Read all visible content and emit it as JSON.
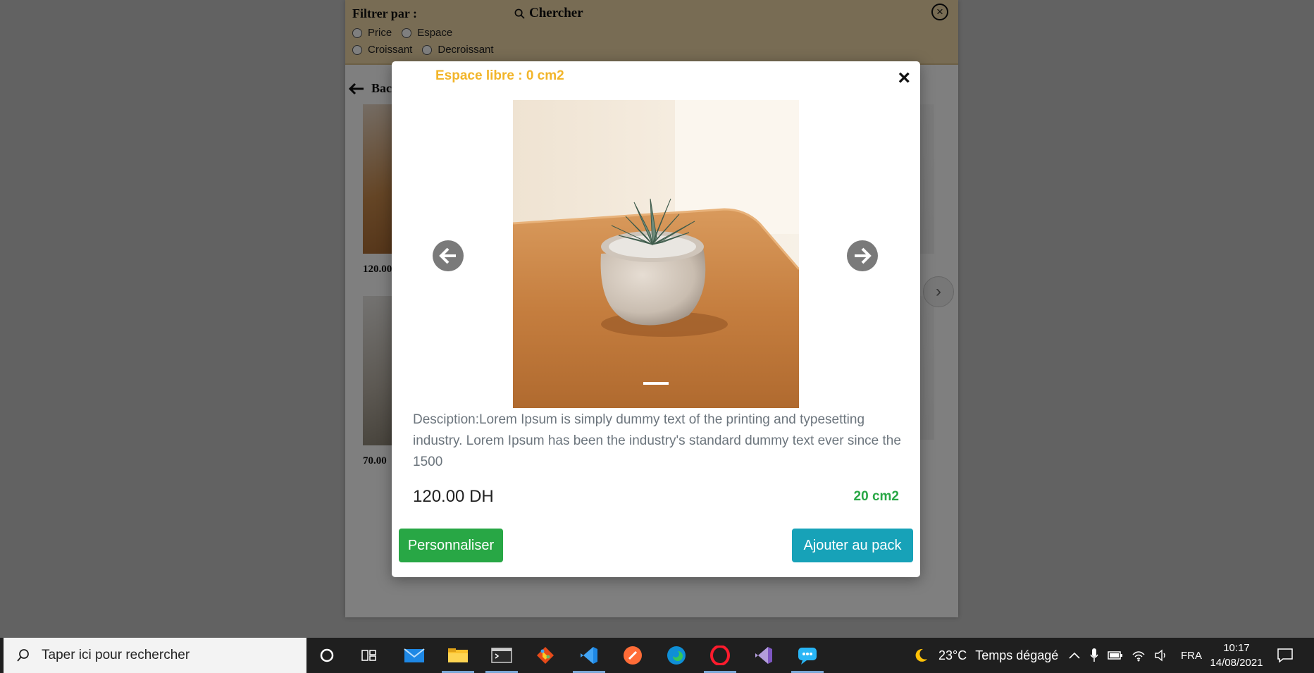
{
  "background_app": {
    "filter_title": "Filtrer par :",
    "search_label": "Chercher",
    "filters_row1": [
      "Price",
      "Espace"
    ],
    "filters_row2": [
      "Croissant",
      "Decroissant"
    ],
    "back_label": "Bac",
    "card_prices": [
      "120.00",
      "70.00"
    ]
  },
  "modal": {
    "espace_libre": "Espace libre : 0 cm2",
    "close_symbol": "×",
    "description": "Desciption:Lorem Ipsum is simply dummy text of the printing and typesetting industry. Lorem Ipsum has been the industry's standard dummy text ever since the 1500",
    "price": "120.00 DH",
    "size": "20 cm2",
    "personnaliser_label": "Personnaliser",
    "ajouter_label": "Ajouter au pack",
    "carousel_image": "succulent plant in pot on wooden table",
    "colors": {
      "espace": "#f2b52a",
      "green": "#28a745",
      "teal": "#17a2b8"
    }
  },
  "taskbar": {
    "search_placeholder": "Taper ici pour rechercher",
    "apps": [
      "cortana-icon",
      "task-view-icon",
      "mail-icon",
      "file-explorer-icon",
      "terminal-icon",
      "git-icon",
      "vscode-icon",
      "postman-icon",
      "edge-icon",
      "opera-icon",
      "visual-studio-icon",
      "chat-icon"
    ],
    "weather_temp": "23°C",
    "weather_text": "Temps dégagé",
    "language": "FRA",
    "time": "10:17",
    "date": "14/08/2021"
  }
}
